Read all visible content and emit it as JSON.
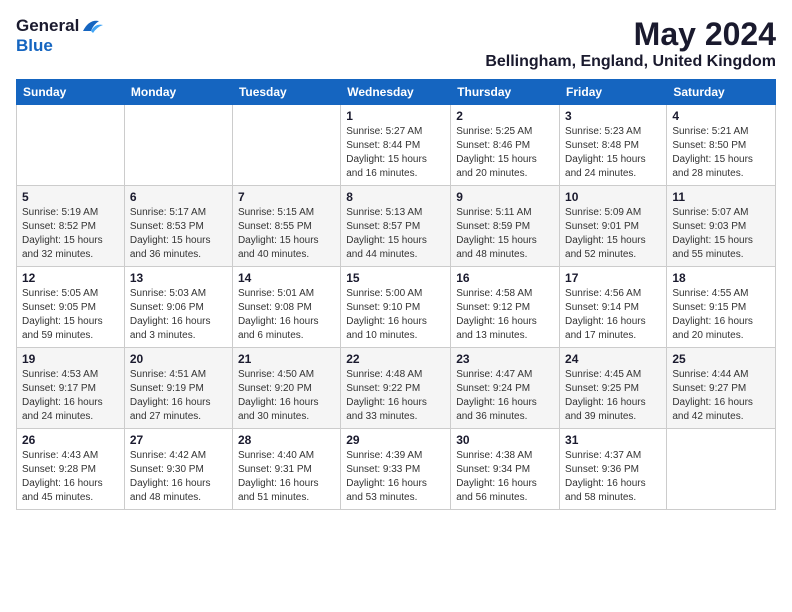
{
  "header": {
    "logo_general": "General",
    "logo_blue": "Blue",
    "month": "May 2024",
    "location": "Bellingham, England, United Kingdom"
  },
  "weekdays": [
    "Sunday",
    "Monday",
    "Tuesday",
    "Wednesday",
    "Thursday",
    "Friday",
    "Saturday"
  ],
  "weeks": [
    [
      {
        "day": "",
        "info": ""
      },
      {
        "day": "",
        "info": ""
      },
      {
        "day": "",
        "info": ""
      },
      {
        "day": "1",
        "info": "Sunrise: 5:27 AM\nSunset: 8:44 PM\nDaylight: 15 hours\nand 16 minutes."
      },
      {
        "day": "2",
        "info": "Sunrise: 5:25 AM\nSunset: 8:46 PM\nDaylight: 15 hours\nand 20 minutes."
      },
      {
        "day": "3",
        "info": "Sunrise: 5:23 AM\nSunset: 8:48 PM\nDaylight: 15 hours\nand 24 minutes."
      },
      {
        "day": "4",
        "info": "Sunrise: 5:21 AM\nSunset: 8:50 PM\nDaylight: 15 hours\nand 28 minutes."
      }
    ],
    [
      {
        "day": "5",
        "info": "Sunrise: 5:19 AM\nSunset: 8:52 PM\nDaylight: 15 hours\nand 32 minutes."
      },
      {
        "day": "6",
        "info": "Sunrise: 5:17 AM\nSunset: 8:53 PM\nDaylight: 15 hours\nand 36 minutes."
      },
      {
        "day": "7",
        "info": "Sunrise: 5:15 AM\nSunset: 8:55 PM\nDaylight: 15 hours\nand 40 minutes."
      },
      {
        "day": "8",
        "info": "Sunrise: 5:13 AM\nSunset: 8:57 PM\nDaylight: 15 hours\nand 44 minutes."
      },
      {
        "day": "9",
        "info": "Sunrise: 5:11 AM\nSunset: 8:59 PM\nDaylight: 15 hours\nand 48 minutes."
      },
      {
        "day": "10",
        "info": "Sunrise: 5:09 AM\nSunset: 9:01 PM\nDaylight: 15 hours\nand 52 minutes."
      },
      {
        "day": "11",
        "info": "Sunrise: 5:07 AM\nSunset: 9:03 PM\nDaylight: 15 hours\nand 55 minutes."
      }
    ],
    [
      {
        "day": "12",
        "info": "Sunrise: 5:05 AM\nSunset: 9:05 PM\nDaylight: 15 hours\nand 59 minutes."
      },
      {
        "day": "13",
        "info": "Sunrise: 5:03 AM\nSunset: 9:06 PM\nDaylight: 16 hours\nand 3 minutes."
      },
      {
        "day": "14",
        "info": "Sunrise: 5:01 AM\nSunset: 9:08 PM\nDaylight: 16 hours\nand 6 minutes."
      },
      {
        "day": "15",
        "info": "Sunrise: 5:00 AM\nSunset: 9:10 PM\nDaylight: 16 hours\nand 10 minutes."
      },
      {
        "day": "16",
        "info": "Sunrise: 4:58 AM\nSunset: 9:12 PM\nDaylight: 16 hours\nand 13 minutes."
      },
      {
        "day": "17",
        "info": "Sunrise: 4:56 AM\nSunset: 9:14 PM\nDaylight: 16 hours\nand 17 minutes."
      },
      {
        "day": "18",
        "info": "Sunrise: 4:55 AM\nSunset: 9:15 PM\nDaylight: 16 hours\nand 20 minutes."
      }
    ],
    [
      {
        "day": "19",
        "info": "Sunrise: 4:53 AM\nSunset: 9:17 PM\nDaylight: 16 hours\nand 24 minutes."
      },
      {
        "day": "20",
        "info": "Sunrise: 4:51 AM\nSunset: 9:19 PM\nDaylight: 16 hours\nand 27 minutes."
      },
      {
        "day": "21",
        "info": "Sunrise: 4:50 AM\nSunset: 9:20 PM\nDaylight: 16 hours\nand 30 minutes."
      },
      {
        "day": "22",
        "info": "Sunrise: 4:48 AM\nSunset: 9:22 PM\nDaylight: 16 hours\nand 33 minutes."
      },
      {
        "day": "23",
        "info": "Sunrise: 4:47 AM\nSunset: 9:24 PM\nDaylight: 16 hours\nand 36 minutes."
      },
      {
        "day": "24",
        "info": "Sunrise: 4:45 AM\nSunset: 9:25 PM\nDaylight: 16 hours\nand 39 minutes."
      },
      {
        "day": "25",
        "info": "Sunrise: 4:44 AM\nSunset: 9:27 PM\nDaylight: 16 hours\nand 42 minutes."
      }
    ],
    [
      {
        "day": "26",
        "info": "Sunrise: 4:43 AM\nSunset: 9:28 PM\nDaylight: 16 hours\nand 45 minutes."
      },
      {
        "day": "27",
        "info": "Sunrise: 4:42 AM\nSunset: 9:30 PM\nDaylight: 16 hours\nand 48 minutes."
      },
      {
        "day": "28",
        "info": "Sunrise: 4:40 AM\nSunset: 9:31 PM\nDaylight: 16 hours\nand 51 minutes."
      },
      {
        "day": "29",
        "info": "Sunrise: 4:39 AM\nSunset: 9:33 PM\nDaylight: 16 hours\nand 53 minutes."
      },
      {
        "day": "30",
        "info": "Sunrise: 4:38 AM\nSunset: 9:34 PM\nDaylight: 16 hours\nand 56 minutes."
      },
      {
        "day": "31",
        "info": "Sunrise: 4:37 AM\nSunset: 9:36 PM\nDaylight: 16 hours\nand 58 minutes."
      },
      {
        "day": "",
        "info": ""
      }
    ]
  ]
}
